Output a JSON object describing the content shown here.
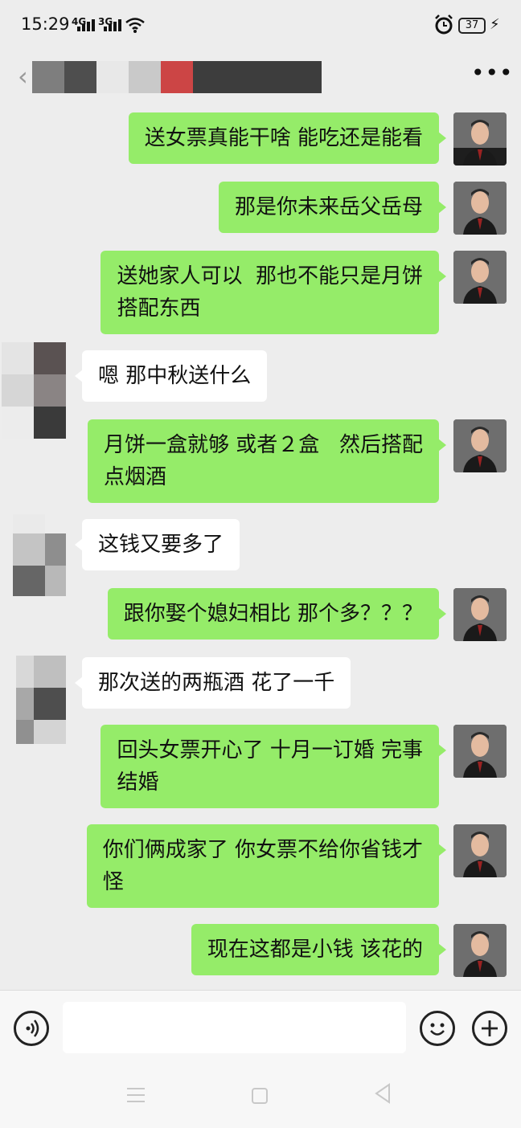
{
  "status_bar": {
    "time": "15:29",
    "network_1": "4G",
    "network_2": "3G",
    "battery": "37",
    "icons": [
      "signal-icon",
      "wifi-icon",
      "alarm-icon",
      "charging-icon"
    ]
  },
  "nav_bar": {
    "back_icon": "‹",
    "more_icon": "•••"
  },
  "messages": [
    {
      "side": "me",
      "text": "送女票真能干啥 能吃还是能看"
    },
    {
      "side": "me",
      "text": "那是你未来岳父岳母"
    },
    {
      "side": "me",
      "text": "送她家人可以  那也不能只是月饼\n搭配东西"
    },
    {
      "side": "other",
      "text": "嗯 那中秋送什么"
    },
    {
      "side": "me",
      "text": "月饼一盒就够 或者２盒   然后搭配\n点烟酒"
    },
    {
      "side": "other",
      "text": "这钱又要多了"
    },
    {
      "side": "me",
      "text": "跟你娶个媳妇相比 那个多？？？"
    },
    {
      "side": "other",
      "text": "那次送的两瓶酒 花了一千"
    },
    {
      "side": "me",
      "text": "回头女票开心了 十月一订婚 完事\n结婚"
    },
    {
      "side": "me",
      "text": "你们俩成家了 你女票不给你省钱才\n怪"
    },
    {
      "side": "me",
      "text": "现在这都是小钱 该花的"
    }
  ],
  "input_bar": {
    "placeholder": "",
    "voice_icon": "voice-icon",
    "emoji_icon": "emoji-icon",
    "plus_icon": "plus-icon"
  },
  "colors": {
    "background": "#ededed",
    "my_bubble": "#95ec69",
    "other_bubble": "#ffffff"
  }
}
